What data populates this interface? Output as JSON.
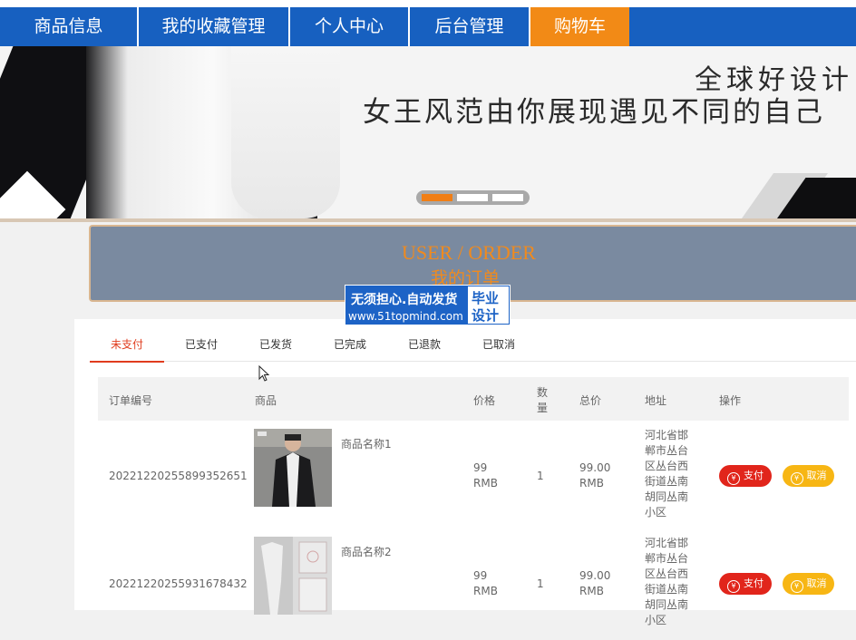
{
  "nav": {
    "items": [
      "商品信息",
      "我的收藏管理",
      "个人中心",
      "后台管理",
      "购物车"
    ],
    "active_index": 4
  },
  "banner": {
    "line1": "全球好设计",
    "line2": "女王风范由你展现遇见不同的自己",
    "slides": 3,
    "active_slide": 0
  },
  "order_header": {
    "title_en": "USER / ORDER",
    "title_cn": "我的订单"
  },
  "watermark": {
    "line1": "无须担心.自动发货",
    "line2": "www.51topmind.com",
    "badge_line1": "毕业",
    "badge_line2": "设计"
  },
  "tabs": [
    "未支付",
    "已支付",
    "已发货",
    "已完成",
    "已退款",
    "已取消"
  ],
  "active_tab": 0,
  "table": {
    "headers": {
      "order_no": "订单编号",
      "product": "商品",
      "price": "价格",
      "qty_l1": "数",
      "qty_l2": "量",
      "total": "总价",
      "address": "地址",
      "actions": "操作"
    },
    "rows": [
      {
        "order_no": "20221220255899352651",
        "product_name": "商品名称1",
        "price_l1": "99",
        "price_l2": "RMB",
        "qty": "1",
        "total_l1": "99.00",
        "total_l2": "RMB",
        "address_lines": [
          "河北省邯",
          "郸市丛台",
          "区丛台西",
          "街道丛南",
          "胡同丛南",
          "小区"
        ],
        "pay_label": "支付",
        "cancel_label": "取消"
      },
      {
        "order_no": "20221220255931678432",
        "product_name": "商品名称2",
        "price_l1": "99",
        "price_l2": "RMB",
        "qty": "1",
        "total_l1": "99.00",
        "total_l2": "RMB",
        "address_lines": [
          "河北省邯",
          "郸市丛台",
          "区丛台西",
          "街道丛南",
          "胡同丛南",
          "小区"
        ],
        "pay_label": "支付",
        "cancel_label": "取消"
      }
    ]
  },
  "colors": {
    "nav_bg": "#1760c0",
    "nav_active": "#f28a16",
    "accent_red": "#e1251b",
    "accent_yellow": "#f7b614",
    "order_title": "#f08a1e"
  }
}
